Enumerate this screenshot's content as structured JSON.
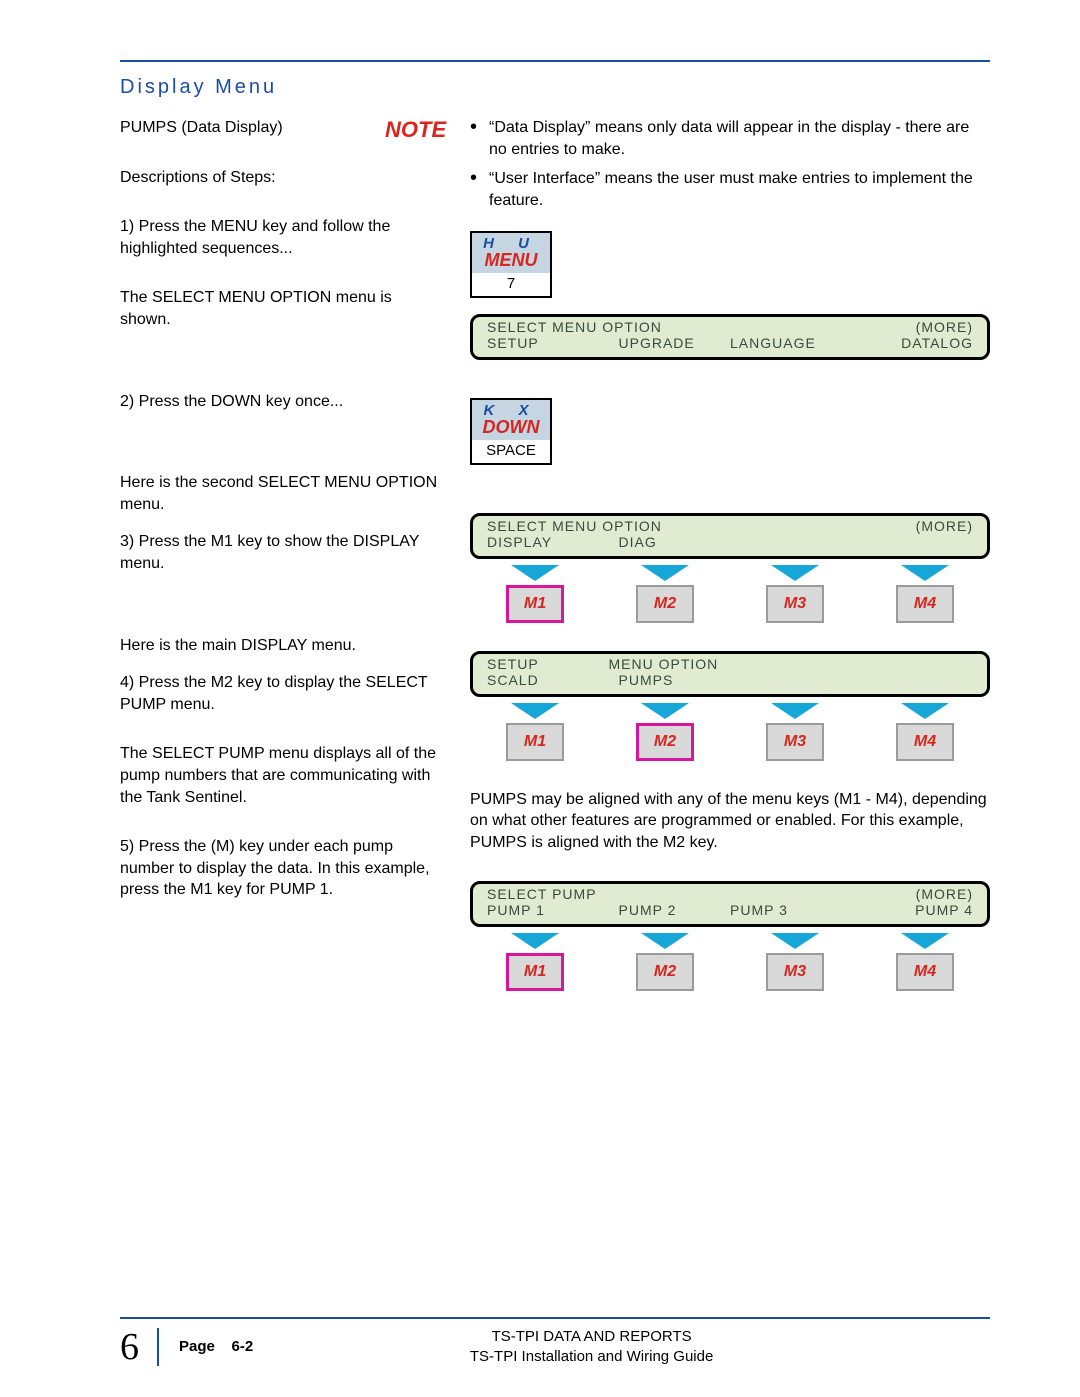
{
  "heading": "Display Menu",
  "note_label": "NOTE",
  "left": {
    "p1": "PUMPS (Data Display)",
    "p2": "Descriptions of Steps:",
    "p3": "1) Press the MENU key and follow the highlighted sequences...",
    "p4": "The SELECT MENU OPTION menu is shown.",
    "p5": "2) Press the DOWN key once...",
    "p6": "Here is the second SELECT MENU OPTION menu.",
    "p7": "3) Press the M1 key to show the DISPLAY menu.",
    "p8": "Here is the main DISPLAY menu.",
    "p9": "4) Press the M2 key to display the SELECT PUMP menu.",
    "p10": "The SELECT PUMP menu displays all of the pump numbers that are communicating with the Tank Sentinel.",
    "p11": "5) Press the (M) key under each pump number to display the data.  In this example, press the M1 key for PUMP 1."
  },
  "right": {
    "bullet1": "“Data Display” means only data will appear in the display - there are no entries to make.",
    "bullet2": "“User Interface” means the user must make entries to implement the feature.",
    "pumps_note": "PUMPS may be aligned with any of the menu keys (M1 - M4), depending on what other features are programmed or enabled.  For this example, PUMPS is aligned with the M2 key."
  },
  "key_menu": {
    "hu": "H   U",
    "word": "MENU",
    "num": "7"
  },
  "key_down": {
    "hu": "K   X",
    "word": "DOWN",
    "sub": "SPACE"
  },
  "lcd1": {
    "r1a": "SELECT MENU OPTION",
    "r1b": "(MORE)",
    "r2a": "SETUP",
    "r2b": "UPGRADE",
    "r2c": "LANGUAGE",
    "r2d": "DATALOG"
  },
  "lcd2": {
    "r1a": "SELECT MENU OPTION",
    "r1b": "(MORE)",
    "r2a": "DISPLAY",
    "r2b": "DIAG"
  },
  "lcd3": {
    "r1a": "SETUP",
    "r1b": "MENU OPTION",
    "r2a": "SCALD",
    "r2b": "PUMPS"
  },
  "lcd4": {
    "r1a": "SELECT PUMP",
    "r1b": "(MORE)",
    "r2a": "PUMP 1",
    "r2b": "PUMP 2",
    "r2c": "PUMP 3",
    "r2d": "PUMP 4"
  },
  "mbtn": {
    "m1": "M1",
    "m2": "M2",
    "m3": "M3",
    "m4": "M4"
  },
  "footer": {
    "chapter": "6",
    "page_label": "Page",
    "page_num": "6-2",
    "title_l1": "TS-TPI DATA AND REPORTS",
    "title_l2": "TS-TPI Installation and Wiring Guide"
  }
}
